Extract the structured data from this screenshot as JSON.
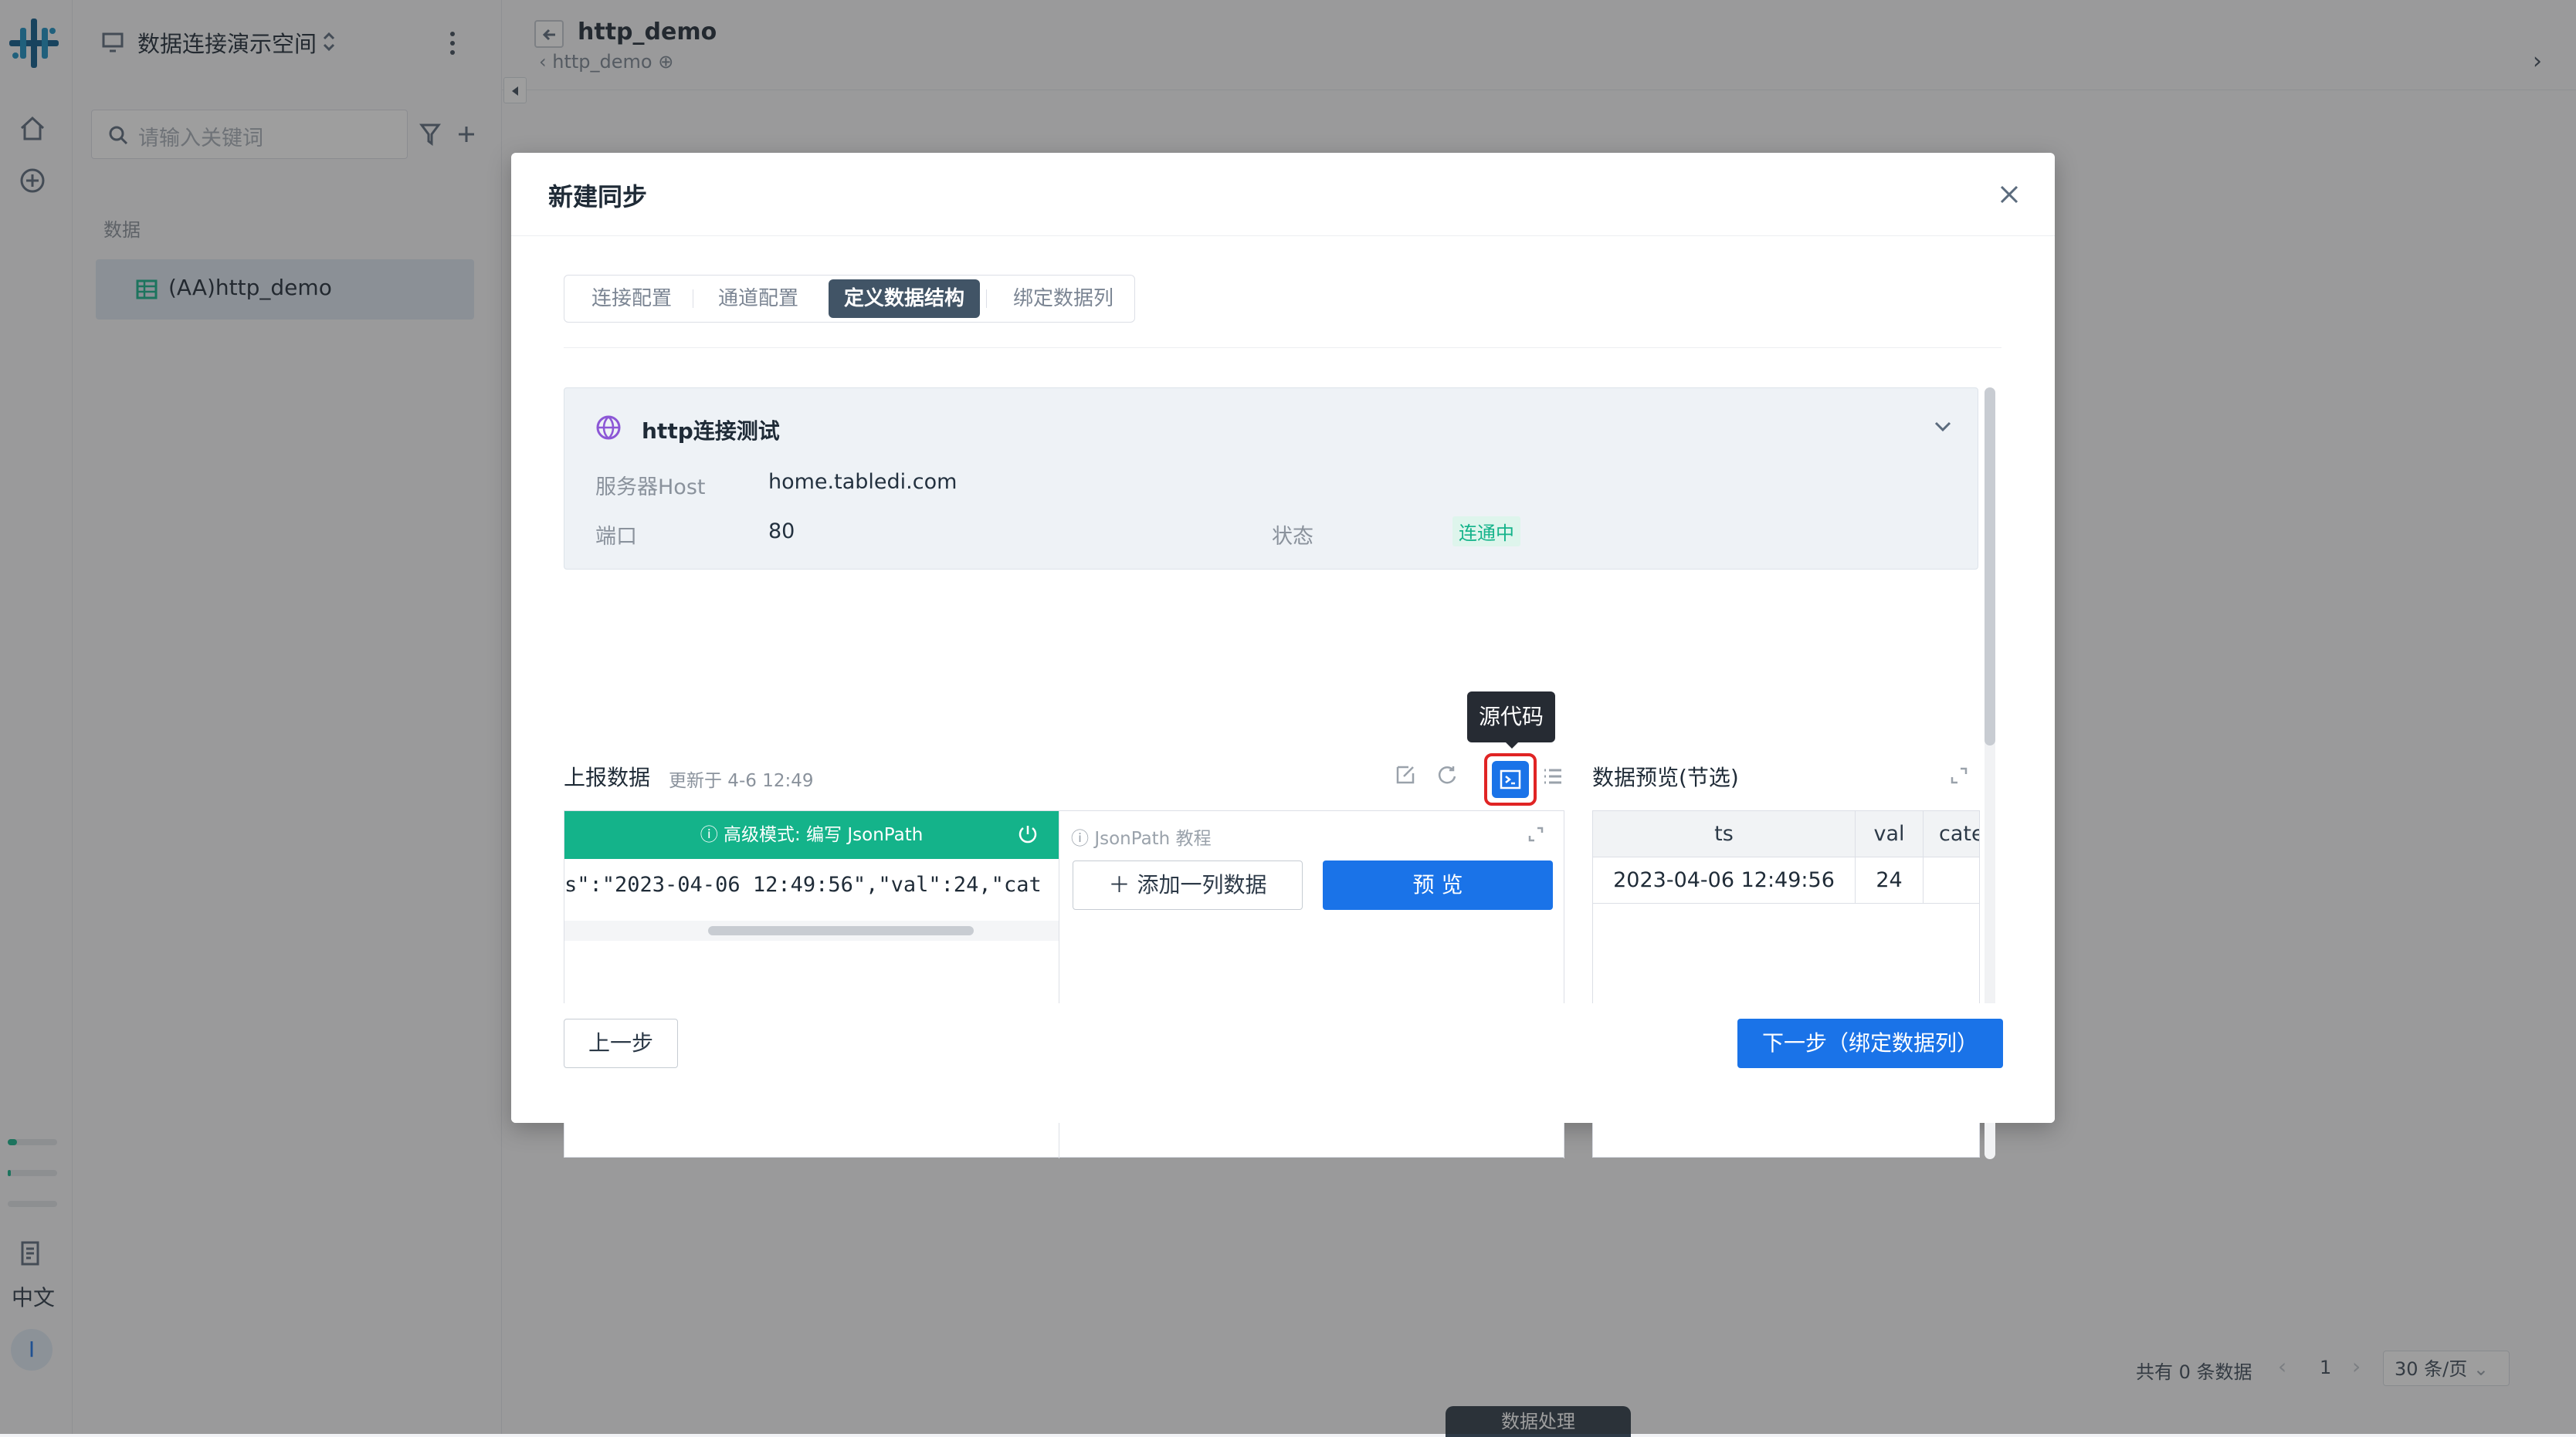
{
  "workspace": {
    "name": "数据连接演示空间"
  },
  "sidebar": {
    "search_placeholder": "请输入关键词",
    "section_label": "数据",
    "item_label": "(AA)http_demo"
  },
  "rail": {
    "language": "中文",
    "user_initial": "I"
  },
  "page": {
    "title": "http_demo",
    "breadcrumb": "http_demo"
  },
  "bottom_bar": {
    "total": "共有 0 条数据",
    "page_num": "1",
    "page_size": "30 条/页",
    "floating_tab": "数据处理"
  },
  "modal": {
    "title": "新建同步",
    "tabs": [
      "连接配置",
      "通道配置",
      "定义数据结构",
      "绑定数据列"
    ],
    "connection": {
      "name": "http连接测试",
      "host_label": "服务器Host",
      "host_value": "home.tabledi.com",
      "port_label": "端口",
      "port_value": "80",
      "status_label": "状态",
      "status_value": "连通中"
    },
    "report": {
      "title": "上报数据",
      "updated": "更新于 4-6 12:49",
      "tooltip": "源代码"
    },
    "jsonpath": {
      "banner": "高级模式: 编写 JsonPath",
      "code_line": "s\":\"2023-04-06 12:49:56\",\"val\":24,\"cat",
      "tutorial": "JsonPath 教程",
      "add_column": "添加一列数据",
      "preview_btn": "预 览"
    },
    "preview": {
      "title": "数据预览(节选)",
      "columns": [
        "ts",
        "val",
        "cate"
      ],
      "rows": [
        [
          "2023-04-06 12:49:56",
          "24",
          ""
        ]
      ]
    },
    "footer": {
      "prev": "上一步",
      "next": "下一步（绑定数据列）"
    }
  },
  "colors": {
    "primary": "#1a73e8",
    "green": "#14b38a",
    "tab_active": "#415466"
  }
}
